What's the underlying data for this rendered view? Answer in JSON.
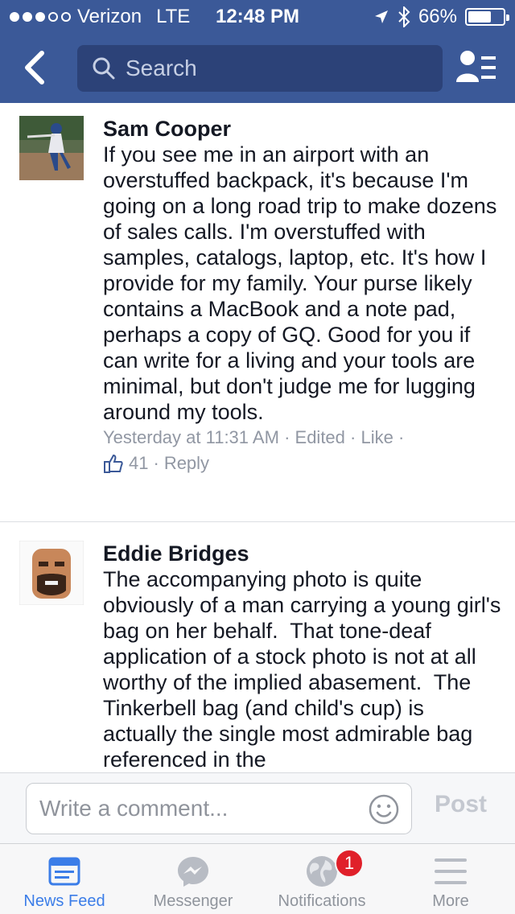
{
  "status_bar": {
    "carrier": "Verizon",
    "network": "LTE",
    "time": "12:48 PM",
    "battery": "66%",
    "battery_level": 0.66
  },
  "nav": {
    "search_placeholder": "Search",
    "icons": {
      "back": "chevron-left-icon",
      "search": "search-icon",
      "friends": "friends-list-icon"
    }
  },
  "comments": [
    {
      "author": "Sam Cooper",
      "text": "If you see me in an airport with an overstuffed backpack, it's because I'm going on a long road trip to make dozens of sales calls. I'm overstuffed with samples, catalogs, laptop, etc. It's how I provide for my family. Your purse likely contains a MacBook and a note pad, perhaps a copy of GQ. Good for you if can write for a living and your tools are minimal, but don't judge me for lugging around my tools.",
      "timestamp": "Yesterday at 11:31 AM",
      "edited": "Edited",
      "like_label": "Like",
      "like_count": "41",
      "reply_label": "Reply"
    },
    {
      "author": "Eddie Bridges",
      "text": "The accompanying photo is quite obviously of a man carrying a young girl's bag on her behalf.  That tone-deaf application of a stock photo is not at all worthy of the implied abasement.  The Tinkerbell bag (and child's cup) is actually the single most admirable bag referenced in the"
    }
  ],
  "composer": {
    "placeholder": "Write a comment...",
    "post_label": "Post"
  },
  "tabs": [
    {
      "label": "News Feed",
      "icon": "news-feed-icon",
      "active": true
    },
    {
      "label": "Messenger",
      "icon": "messenger-icon",
      "active": false
    },
    {
      "label": "Notifications",
      "icon": "globe-icon",
      "active": false,
      "badge": "1"
    },
    {
      "label": "More",
      "icon": "menu-icon",
      "active": false
    }
  ],
  "colors": {
    "brand": "#3b5998",
    "active_tab": "#3b7de8",
    "badge": "#e0202a"
  }
}
